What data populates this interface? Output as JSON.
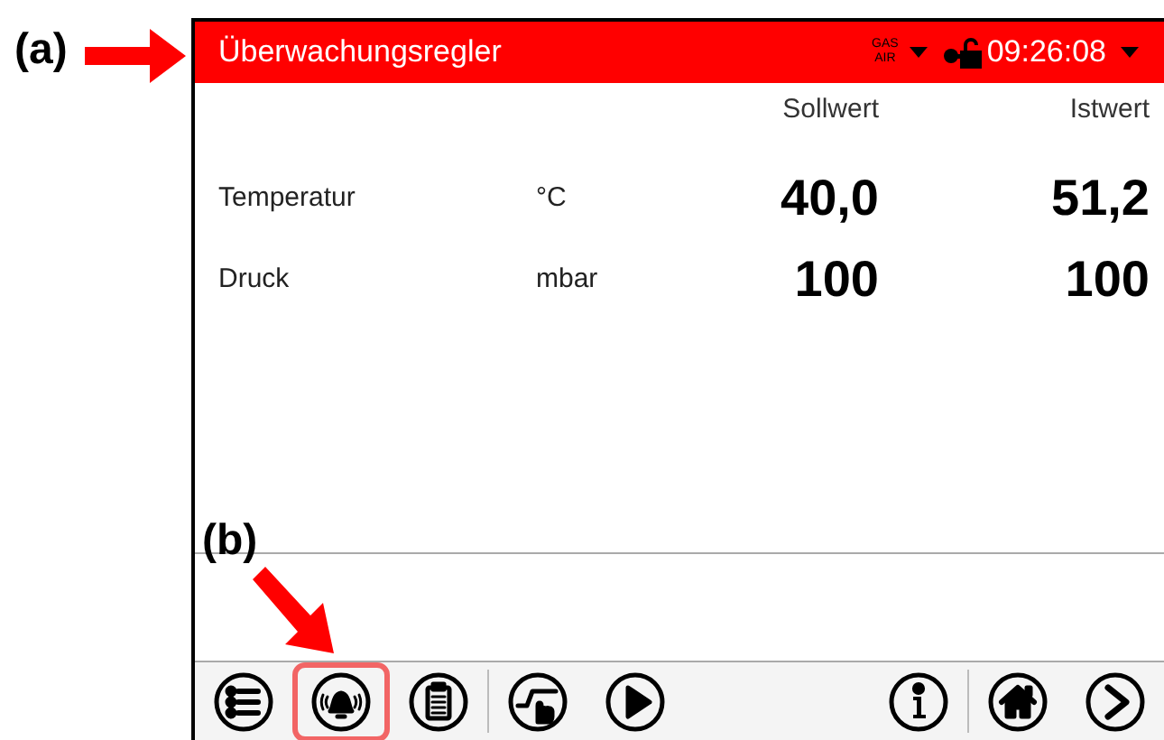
{
  "annotations": [
    {
      "label": "(a)"
    },
    {
      "label": "(b)"
    }
  ],
  "header": {
    "title": "Überwachungsregler",
    "gas_label_top": "GAS",
    "gas_label_bottom": "AIR",
    "time": "09:26:08"
  },
  "columns": [
    "Sollwert",
    "Istwert"
  ],
  "rows": [
    {
      "name": "Temperatur",
      "unit": "°C",
      "setpoint": "40,0",
      "actual": "51,2"
    },
    {
      "name": "Druck",
      "unit": "mbar",
      "setpoint": "100",
      "actual": "100"
    }
  ],
  "toolbar": {
    "left_groups": [
      [
        {
          "kind": "menu",
          "highlighted": false
        },
        {
          "kind": "alarm",
          "highlighted": true
        },
        {
          "kind": "clipboard",
          "highlighted": false
        }
      ],
      [
        {
          "kind": "manual",
          "highlighted": false
        },
        {
          "kind": "play",
          "highlighted": false
        }
      ]
    ],
    "right_groups": [
      [
        {
          "kind": "info",
          "highlighted": false
        }
      ],
      [
        {
          "kind": "home",
          "highlighted": false
        },
        {
          "kind": "next",
          "highlighted": false
        }
      ]
    ]
  }
}
